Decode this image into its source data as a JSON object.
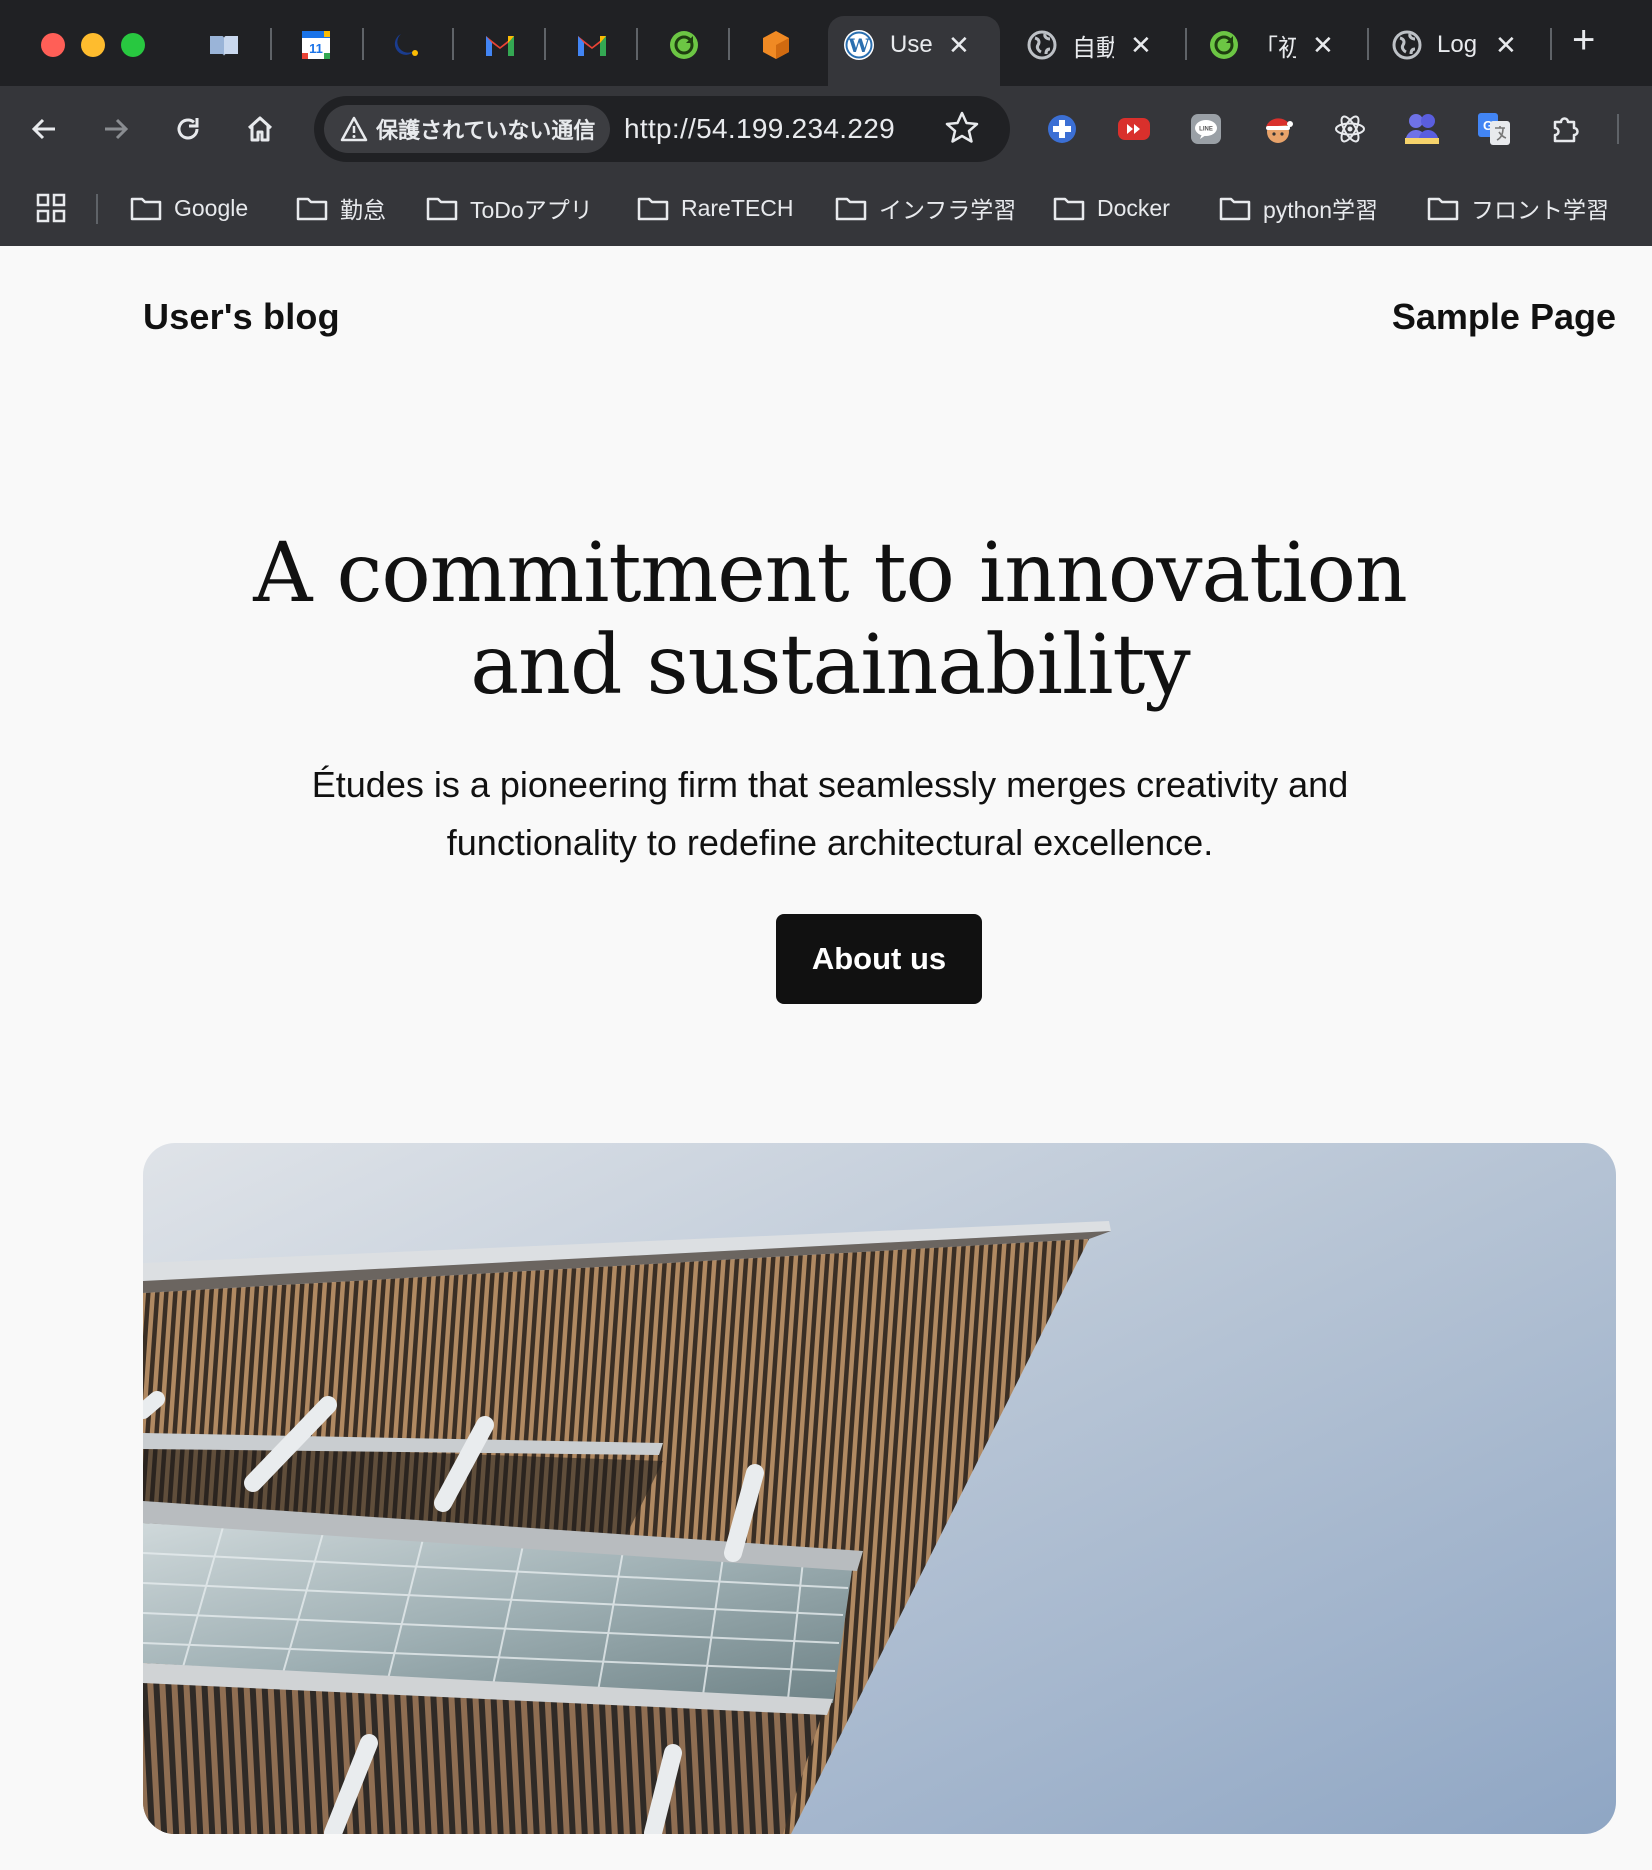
{
  "browser": {
    "tabs": [
      {
        "icon": "book-icon"
      },
      {
        "icon": "calendar-icon",
        "badge": "11"
      },
      {
        "icon": "moon-app-icon"
      },
      {
        "icon": "gmail-icon"
      },
      {
        "icon": "gmail-icon"
      },
      {
        "icon": "green-refresh-icon"
      },
      {
        "icon": "orange-cube-icon"
      },
      {
        "icon": "wordpress-icon",
        "title": "Use",
        "active": true
      },
      {
        "icon": "globe-icon",
        "title": "自動"
      },
      {
        "icon": "green-refresh-icon",
        "title": "「初"
      },
      {
        "icon": "globe-icon",
        "title": "Log"
      }
    ],
    "new_tab_label": "+",
    "security_label": "保護されていない通信",
    "url": "http://54.199.234.229",
    "bookmarks": [
      {
        "label": "Google"
      },
      {
        "label": "勤怠"
      },
      {
        "label": "ToDoアプリ"
      },
      {
        "label": "RareTECH"
      },
      {
        "label": "インフラ学習"
      },
      {
        "label": "Docker"
      },
      {
        "label": "python学習"
      },
      {
        "label": "フロント学習"
      }
    ]
  },
  "site": {
    "title": "User's blog",
    "nav": [
      "Sample Page"
    ]
  },
  "hero": {
    "heading": "A commitment to innovation and sustainability",
    "text": "Études is a pioneering firm that seamlessly merges creativity and functionality to redefine architectural excellence.",
    "button": "About us"
  },
  "colors": {
    "page_bg": "#f9f9f9",
    "text": "#111111",
    "button_bg": "#111111",
    "chrome_dark": "#202124",
    "chrome_toolbar": "#35363a"
  }
}
